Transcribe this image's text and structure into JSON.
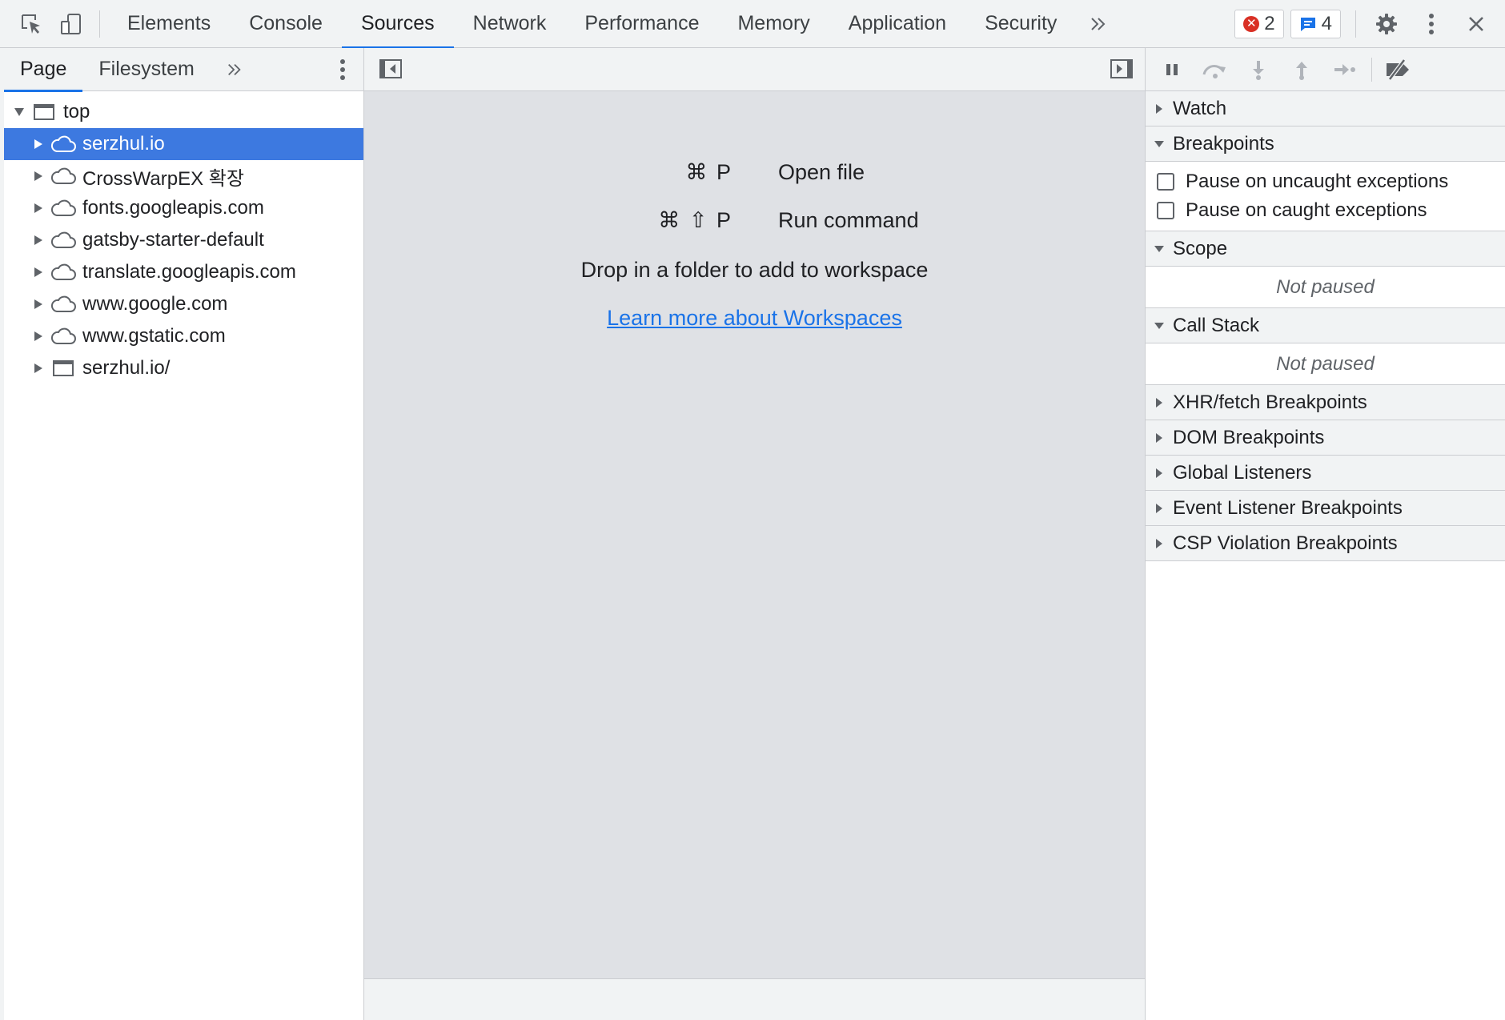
{
  "toolbar": {
    "tabs": [
      {
        "label": "Elements"
      },
      {
        "label": "Console"
      },
      {
        "label": "Sources"
      },
      {
        "label": "Network"
      },
      {
        "label": "Performance"
      },
      {
        "label": "Memory"
      },
      {
        "label": "Application"
      },
      {
        "label": "Security"
      }
    ],
    "active_tab": "Sources",
    "error_count": "2",
    "message_count": "4",
    "icons": [
      "inspect-element-icon",
      "device-toolbar-icon",
      "more-tabs-chevron-icon",
      "settings-gear-icon",
      "kebab-menu-icon",
      "close-icon"
    ],
    "accent_color": "#1a73e8",
    "error_color": "#d93025"
  },
  "navigator": {
    "tabs": [
      {
        "label": "Page"
      },
      {
        "label": "Filesystem"
      }
    ],
    "root": {
      "label": "top",
      "icon": "frame-icon",
      "expanded": true
    },
    "items": [
      {
        "label": "serzhul.io",
        "icon": "cloud-icon",
        "selected": true
      },
      {
        "label": "CrossWarpEX 확장",
        "icon": "cloud-icon"
      },
      {
        "label": "fonts.googleapis.com",
        "icon": "cloud-icon"
      },
      {
        "label": "gatsby-starter-default",
        "icon": "cloud-icon"
      },
      {
        "label": "translate.googleapis.com",
        "icon": "cloud-icon"
      },
      {
        "label": "www.google.com",
        "icon": "cloud-icon"
      },
      {
        "label": "www.gstatic.com",
        "icon": "cloud-icon"
      },
      {
        "label": "serzhul.io/",
        "icon": "frame-icon"
      }
    ],
    "selection_color": "#3d79e0"
  },
  "editor": {
    "shortcuts": [
      {
        "keys": "⌘ P",
        "label": "Open file"
      },
      {
        "keys": "⌘ ⇧ P",
        "label": "Run command"
      }
    ],
    "drop_text": "Drop in a folder to add to workspace",
    "learn_link": "Learn more about Workspaces"
  },
  "debugger": {
    "controls": [
      "pause-icon",
      "step-over-icon",
      "step-into-icon",
      "step-out-icon",
      "step-icon",
      "deactivate-breakpoints-icon"
    ],
    "panes": {
      "watch": "Watch",
      "breakpoints": "Breakpoints",
      "pause_uncaught": "Pause on uncaught exceptions",
      "pause_caught": "Pause on caught exceptions",
      "scope": "Scope",
      "scope_status": "Not paused",
      "call_stack": "Call Stack",
      "call_stack_status": "Not paused",
      "xhr": "XHR/fetch Breakpoints",
      "dom": "DOM Breakpoints",
      "global": "Global Listeners",
      "event": "Event Listener Breakpoints",
      "csp": "CSP Violation Breakpoints"
    }
  }
}
